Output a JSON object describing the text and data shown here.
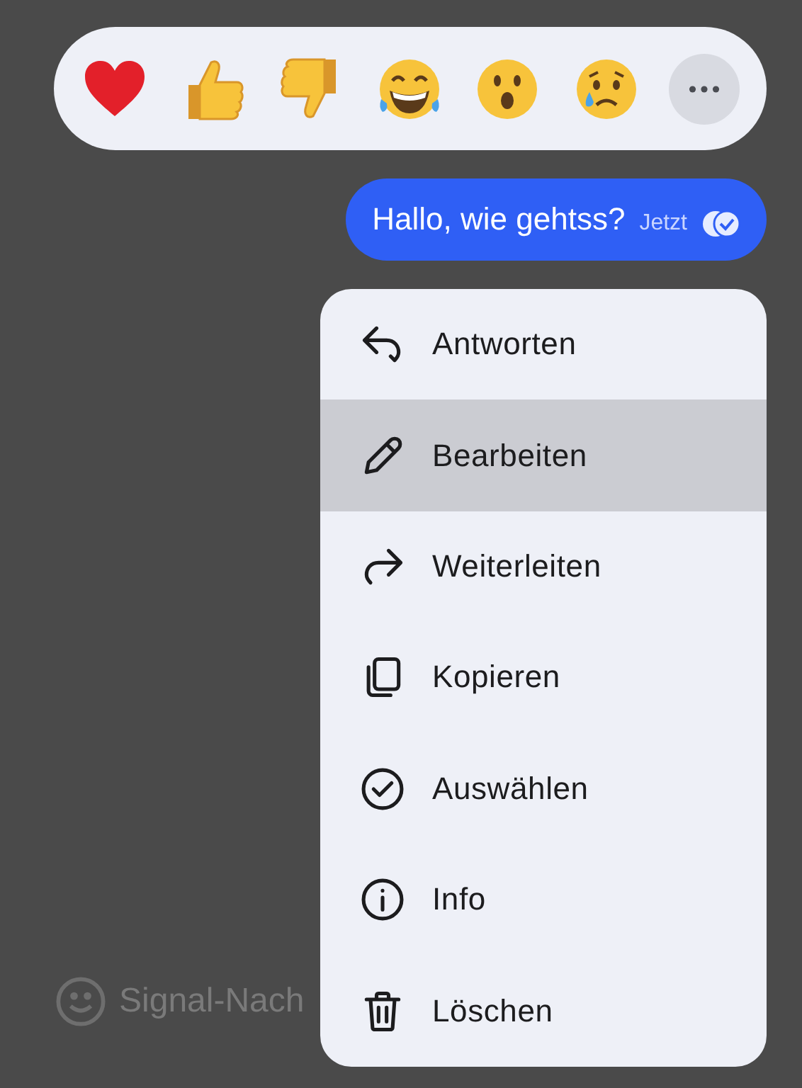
{
  "composer": {
    "placeholder": "Signal-Nach"
  },
  "reactions": [
    {
      "kind": "heart"
    },
    {
      "kind": "thumbs-up"
    },
    {
      "kind": "thumbs-down"
    },
    {
      "kind": "laughing"
    },
    {
      "kind": "surprised"
    },
    {
      "kind": "crying"
    },
    {
      "kind": "more"
    }
  ],
  "message": {
    "text": "Hallo, wie gehtss?",
    "time": "Jetzt",
    "read": true
  },
  "menu": [
    {
      "kind": "reply",
      "label": "Antworten",
      "selected": false
    },
    {
      "kind": "edit",
      "label": "Bearbeiten",
      "selected": true
    },
    {
      "kind": "forward",
      "label": "Weiterleiten",
      "selected": false
    },
    {
      "kind": "copy",
      "label": "Kopieren",
      "selected": false
    },
    {
      "kind": "select",
      "label": "Auswählen",
      "selected": false
    },
    {
      "kind": "info",
      "label": "Info",
      "selected": false
    },
    {
      "kind": "delete",
      "label": "Löschen",
      "selected": false
    }
  ]
}
